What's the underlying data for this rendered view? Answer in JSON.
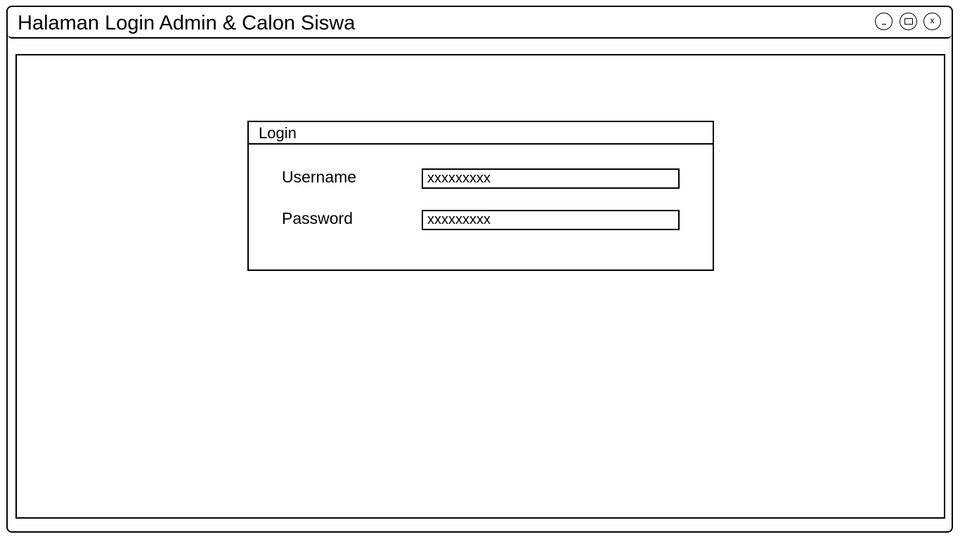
{
  "window": {
    "title": "Halaman Login Admin & Calon Siswa",
    "buttons": {
      "minimize_icon": "minimize-icon",
      "maximize_icon": "maximize-icon",
      "close_icon": "close-icon",
      "close_glyph": "x"
    }
  },
  "login": {
    "title": "Login",
    "username": {
      "label": "Username",
      "value": "xxxxxxxxx"
    },
    "password": {
      "label": "Password",
      "value": "xxxxxxxxx"
    }
  }
}
